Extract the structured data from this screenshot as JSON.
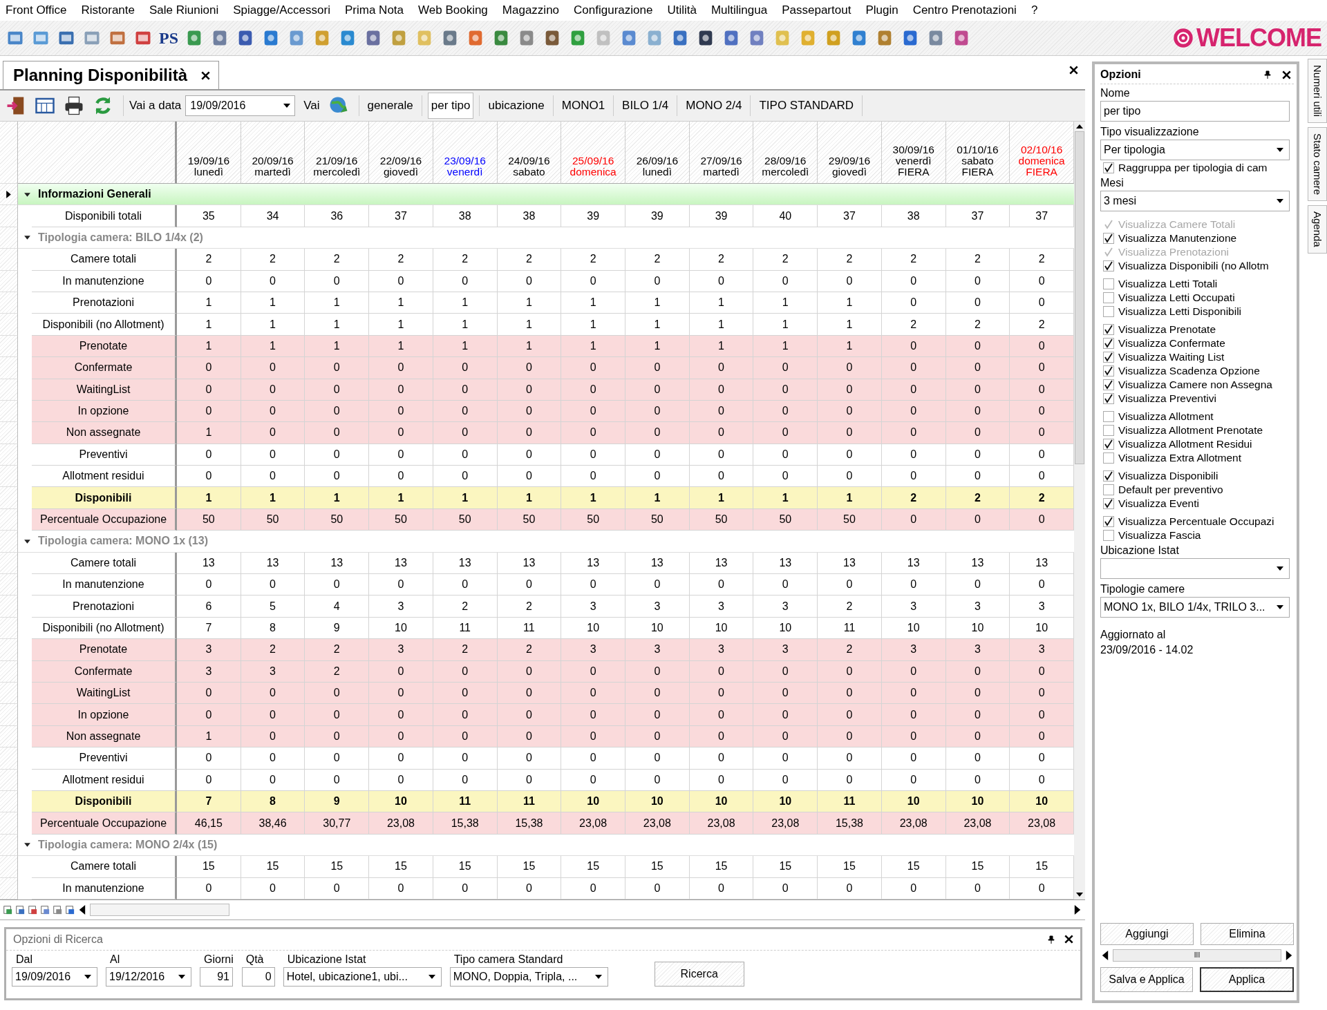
{
  "menu": [
    "Front Office",
    "Ristorante",
    "Sale Riunioni",
    "Spiagge/Accessori",
    "Prima Nota",
    "Web Booking",
    "Magazzino",
    "Configurazione",
    "Utilità",
    "Multilingua",
    "Passepartout",
    "Plugin",
    "Centro Prenotazioni",
    "?"
  ],
  "toolbar": {
    "label": "PS",
    "logo": "WELCOME"
  },
  "document_tab": {
    "title": "Planning Disponibilità"
  },
  "subtoolbar": {
    "goto_label": "Vai a data",
    "date": "19/09/2016",
    "go_button": "Vai",
    "views": [
      {
        "label": "generale",
        "selected": false
      },
      {
        "label": "per tipo",
        "selected": true
      },
      {
        "label": "ubicazione",
        "selected": false
      },
      {
        "label": "MONO1",
        "selected": false
      },
      {
        "label": "BILO 1/4",
        "selected": false
      },
      {
        "label": "MONO 2/4",
        "selected": false
      },
      {
        "label": "TIPO STANDARD",
        "selected": false
      }
    ]
  },
  "table": {
    "columns": [
      {
        "date": "19/09/16",
        "day": "lunedì",
        "color": "#000000"
      },
      {
        "date": "20/09/16",
        "day": "martedì",
        "color": "#000000"
      },
      {
        "date": "21/09/16",
        "day": "mercoledì",
        "color": "#000000"
      },
      {
        "date": "22/09/16",
        "day": "giovedì",
        "color": "#000000"
      },
      {
        "date": "23/09/16",
        "day": "venerdì",
        "color": "#0000ff"
      },
      {
        "date": "24/09/16",
        "day": "sabato",
        "color": "#000000"
      },
      {
        "date": "25/09/16",
        "day": "domenica",
        "color": "#ff0000"
      },
      {
        "date": "26/09/16",
        "day": "lunedì",
        "color": "#000000"
      },
      {
        "date": "27/09/16",
        "day": "martedì",
        "color": "#000000"
      },
      {
        "date": "28/09/16",
        "day": "mercoledì",
        "color": "#000000"
      },
      {
        "date": "29/09/16",
        "day": "giovedì",
        "color": "#000000"
      },
      {
        "date": "30/09/16",
        "day": "venerdì",
        "event": "FIERA",
        "color": "#000000"
      },
      {
        "date": "01/10/16",
        "day": "sabato",
        "event": "FIERA",
        "color": "#000000"
      },
      {
        "date": "02/10/16",
        "day": "domenica",
        "event": "FIERA",
        "color": "#ff0000"
      }
    ],
    "rows": [
      {
        "kind": "section",
        "label": "Informazioni Generali",
        "expanded": true,
        "selected": true
      },
      {
        "kind": "row",
        "label": "Disponibili totali",
        "selected": false,
        "cells": [
          "35",
          "34",
          "36",
          "37",
          "38",
          "38",
          "39",
          "39",
          "39",
          "40",
          "37",
          "38",
          "37",
          "37"
        ]
      },
      {
        "kind": "group",
        "label": "Tipologia camera: BILO 1/4x (2)",
        "expanded": true,
        "selected": false
      },
      {
        "kind": "row",
        "label": "Camere totali",
        "selected": false,
        "cells": [
          "2",
          "2",
          "2",
          "2",
          "2",
          "2",
          "2",
          "2",
          "2",
          "2",
          "2",
          "2",
          "2",
          "2"
        ]
      },
      {
        "kind": "row",
        "label": "In manutenzione",
        "selected": false,
        "cells": [
          "0",
          "0",
          "0",
          "0",
          "0",
          "0",
          "0",
          "0",
          "0",
          "0",
          "0",
          "0",
          "0",
          "0"
        ]
      },
      {
        "kind": "row",
        "label": "Prenotazioni",
        "selected": false,
        "cells": [
          "1",
          "1",
          "1",
          "1",
          "1",
          "1",
          "1",
          "1",
          "1",
          "1",
          "1",
          "0",
          "0",
          "0"
        ]
      },
      {
        "kind": "row",
        "label": "Disponibili (no Allotment)",
        "selected": false,
        "cells": [
          "1",
          "1",
          "1",
          "1",
          "1",
          "1",
          "1",
          "1",
          "1",
          "1",
          "1",
          "2",
          "2",
          "2"
        ]
      },
      {
        "kind": "highlighted",
        "label": "Prenotate",
        "selected": false,
        "cells": [
          "1",
          "1",
          "1",
          "1",
          "1",
          "1",
          "1",
          "1",
          "1",
          "1",
          "1",
          "0",
          "0",
          "0"
        ]
      },
      {
        "kind": "highlighted",
        "label": "Confermate",
        "selected": false,
        "cells": [
          "0",
          "0",
          "0",
          "0",
          "0",
          "0",
          "0",
          "0",
          "0",
          "0",
          "0",
          "0",
          "0",
          "0"
        ]
      },
      {
        "kind": "highlighted",
        "label": "WaitingList",
        "selected": false,
        "cells": [
          "0",
          "0",
          "0",
          "0",
          "0",
          "0",
          "0",
          "0",
          "0",
          "0",
          "0",
          "0",
          "0",
          "0"
        ]
      },
      {
        "kind": "highlighted",
        "label": "In opzione",
        "selected": false,
        "cells": [
          "0",
          "0",
          "0",
          "0",
          "0",
          "0",
          "0",
          "0",
          "0",
          "0",
          "0",
          "0",
          "0",
          "0"
        ]
      },
      {
        "kind": "highlighted",
        "label": "Non assegnate",
        "selected": false,
        "cells": [
          "1",
          "0",
          "0",
          "0",
          "0",
          "0",
          "0",
          "0",
          "0",
          "0",
          "0",
          "0",
          "0",
          "0"
        ]
      },
      {
        "kind": "row",
        "label": "Preventivi",
        "selected": false,
        "cells": [
          "0",
          "0",
          "0",
          "0",
          "0",
          "0",
          "0",
          "0",
          "0",
          "0",
          "0",
          "0",
          "0",
          "0"
        ]
      },
      {
        "kind": "row",
        "label": "Allotment residui",
        "selected": false,
        "cells": [
          "0",
          "0",
          "0",
          "0",
          "0",
          "0",
          "0",
          "0",
          "0",
          "0",
          "0",
          "0",
          "0",
          "0"
        ]
      },
      {
        "kind": "total",
        "label": "Disponibili",
        "selected": false,
        "cells": [
          "1",
          "1",
          "1",
          "1",
          "1",
          "1",
          "1",
          "1",
          "1",
          "1",
          "1",
          "2",
          "2",
          "2"
        ]
      },
      {
        "kind": "highlighted",
        "label": "Percentuale Occupazione",
        "selected": false,
        "cells": [
          "50",
          "50",
          "50",
          "50",
          "50",
          "50",
          "50",
          "50",
          "50",
          "50",
          "50",
          "0",
          "0",
          "0"
        ]
      },
      {
        "kind": "group",
        "label": "Tipologia camera: MONO 1x (13)",
        "expanded": true,
        "selected": false
      },
      {
        "kind": "row",
        "label": "Camere totali",
        "selected": false,
        "cells": [
          "13",
          "13",
          "13",
          "13",
          "13",
          "13",
          "13",
          "13",
          "13",
          "13",
          "13",
          "13",
          "13",
          "13"
        ]
      },
      {
        "kind": "row",
        "label": "In manutenzione",
        "selected": false,
        "cells": [
          "0",
          "0",
          "0",
          "0",
          "0",
          "0",
          "0",
          "0",
          "0",
          "0",
          "0",
          "0",
          "0",
          "0"
        ]
      },
      {
        "kind": "row",
        "label": "Prenotazioni",
        "selected": false,
        "cells": [
          "6",
          "5",
          "4",
          "3",
          "2",
          "2",
          "3",
          "3",
          "3",
          "3",
          "2",
          "3",
          "3",
          "3"
        ]
      },
      {
        "kind": "row",
        "label": "Disponibili (no Allotment)",
        "selected": false,
        "cells": [
          "7",
          "8",
          "9",
          "10",
          "11",
          "11",
          "10",
          "10",
          "10",
          "10",
          "11",
          "10",
          "10",
          "10"
        ]
      },
      {
        "kind": "highlighted",
        "label": "Prenotate",
        "selected": false,
        "cells": [
          "3",
          "2",
          "2",
          "3",
          "2",
          "2",
          "3",
          "3",
          "3",
          "3",
          "2",
          "3",
          "3",
          "3"
        ]
      },
      {
        "kind": "highlighted",
        "label": "Confermate",
        "selected": false,
        "cells": [
          "3",
          "3",
          "2",
          "0",
          "0",
          "0",
          "0",
          "0",
          "0",
          "0",
          "0",
          "0",
          "0",
          "0"
        ]
      },
      {
        "kind": "highlighted",
        "label": "WaitingList",
        "selected": false,
        "cells": [
          "0",
          "0",
          "0",
          "0",
          "0",
          "0",
          "0",
          "0",
          "0",
          "0",
          "0",
          "0",
          "0",
          "0"
        ]
      },
      {
        "kind": "highlighted",
        "label": "In opzione",
        "selected": false,
        "cells": [
          "0",
          "0",
          "0",
          "0",
          "0",
          "0",
          "0",
          "0",
          "0",
          "0",
          "0",
          "0",
          "0",
          "0"
        ]
      },
      {
        "kind": "highlighted",
        "label": "Non assegnate",
        "selected": false,
        "cells": [
          "1",
          "0",
          "0",
          "0",
          "0",
          "0",
          "0",
          "0",
          "0",
          "0",
          "0",
          "0",
          "0",
          "0"
        ]
      },
      {
        "kind": "row",
        "label": "Preventivi",
        "selected": false,
        "cells": [
          "0",
          "0",
          "0",
          "0",
          "0",
          "0",
          "0",
          "0",
          "0",
          "0",
          "0",
          "0",
          "0",
          "0"
        ]
      },
      {
        "kind": "row",
        "label": "Allotment residui",
        "selected": false,
        "cells": [
          "0",
          "0",
          "0",
          "0",
          "0",
          "0",
          "0",
          "0",
          "0",
          "0",
          "0",
          "0",
          "0",
          "0"
        ]
      },
      {
        "kind": "total",
        "label": "Disponibili",
        "selected": false,
        "cells": [
          "7",
          "8",
          "9",
          "10",
          "11",
          "11",
          "10",
          "10",
          "10",
          "10",
          "11",
          "10",
          "10",
          "10"
        ]
      },
      {
        "kind": "highlighted",
        "label": "Percentuale Occupazione",
        "selected": false,
        "cells": [
          "46,15",
          "38,46",
          "30,77",
          "23,08",
          "15,38",
          "15,38",
          "23,08",
          "23,08",
          "23,08",
          "23,08",
          "15,38",
          "23,08",
          "23,08",
          "23,08"
        ]
      },
      {
        "kind": "group",
        "label": "Tipologia camera: MONO 2/4x (15)",
        "expanded": true,
        "selected": false
      },
      {
        "kind": "row",
        "label": "Camere totali",
        "selected": false,
        "cells": [
          "15",
          "15",
          "15",
          "15",
          "15",
          "15",
          "15",
          "15",
          "15",
          "15",
          "15",
          "15",
          "15",
          "15"
        ]
      },
      {
        "kind": "row",
        "label": "In manutenzione",
        "selected": false,
        "cells": [
          "0",
          "0",
          "0",
          "0",
          "0",
          "0",
          "0",
          "0",
          "0",
          "0",
          "0",
          "0",
          "0",
          "0"
        ]
      }
    ]
  },
  "options_panel": {
    "title": "Opzioni",
    "name_label": "Nome",
    "name_value": "per tipo",
    "view_label": "Tipo visualizzazione",
    "view_value": "Per tipologia",
    "group_check": {
      "label": "Raggruppa per tipologia di cam",
      "checked": true
    },
    "months_label": "Mesi",
    "months_value": "3 mesi",
    "check_groups": [
      [
        {
          "label": "Visualizza Camere Totali",
          "checked": true,
          "disabled": true
        },
        {
          "label": "Visualizza Manutenzione",
          "checked": true,
          "disabled": false
        },
        {
          "label": "Visualizza Prenotazioni",
          "checked": true,
          "disabled": true
        },
        {
          "label": "Visualizza Disponibili (no Allotm",
          "checked": true,
          "disabled": false
        }
      ],
      [
        {
          "label": "Visualizza Letti Totali",
          "checked": false,
          "disabled": false
        },
        {
          "label": "Visualizza Letti Occupati",
          "checked": false,
          "disabled": false
        },
        {
          "label": "Visualizza Letti Disponibili",
          "checked": false,
          "disabled": false
        }
      ],
      [
        {
          "label": "Visualizza Prenotate",
          "checked": true,
          "disabled": false
        },
        {
          "label": "Visualizza Confermate",
          "checked": true,
          "disabled": false
        },
        {
          "label": "Visualizza Waiting List",
          "checked": true,
          "disabled": false
        },
        {
          "label": "Visualizza Scadenza Opzione",
          "checked": true,
          "disabled": false
        },
        {
          "label": "Visualizza Camere non Assegna",
          "checked": true,
          "disabled": false
        },
        {
          "label": "Visualizza Preventivi",
          "checked": true,
          "disabled": false
        }
      ],
      [
        {
          "label": "Visualizza Allotment",
          "checked": false,
          "disabled": false
        },
        {
          "label": "Visualizza Allotment Prenotate",
          "checked": false,
          "disabled": false
        },
        {
          "label": "Visualizza Allotment Residui",
          "checked": true,
          "disabled": false
        },
        {
          "label": "Visualizza Extra Allotment",
          "checked": false,
          "disabled": false
        }
      ],
      [
        {
          "label": "Visualizza Disponibili",
          "checked": true,
          "disabled": false
        },
        {
          "label": "Default per preventivo",
          "checked": false,
          "disabled": false
        },
        {
          "label": "Visualizza Eventi",
          "checked": true,
          "disabled": false
        }
      ],
      [
        {
          "label": "Visualizza Percentuale Occupazi",
          "checked": true,
          "disabled": false
        },
        {
          "label": "Visualizza Fascia",
          "checked": false,
          "disabled": false
        }
      ]
    ],
    "istat_label": "Ubicazione Istat",
    "types_label": "Tipologie camere",
    "types_value": "MONO 1x, BILO 1/4x, TRILO 3...",
    "updated_label": "Aggiornato al",
    "updated_value": "23/09/2016 - 14.02",
    "buttons": [
      "Aggiungi",
      "Elimina"
    ],
    "scroll_grip": "III",
    "footer_buttons": [
      "Salva e Applica",
      "Applica"
    ]
  },
  "side_tabs": [
    "Numeri utili",
    "Stato camere",
    "Agenda"
  ],
  "search_panel": {
    "title": "Opzioni di Ricerca",
    "fields": [
      {
        "kind": "combo",
        "label": "Dal",
        "value": "19/09/2016"
      },
      {
        "kind": "combo",
        "label": "Al",
        "value": "19/12/2016"
      },
      {
        "kind": "number",
        "label": "Giorni",
        "value": "91"
      },
      {
        "kind": "number",
        "label": "Qtà",
        "value": "0"
      },
      {
        "kind": "combo",
        "label": "Ubicazione Istat",
        "value": "Hotel, ubicazione1, ubi..."
      },
      {
        "kind": "combo",
        "label": "Tipo camera Standard",
        "value": "MONO, Doppia, Tripla, ..."
      }
    ],
    "button": "Ricerca"
  }
}
